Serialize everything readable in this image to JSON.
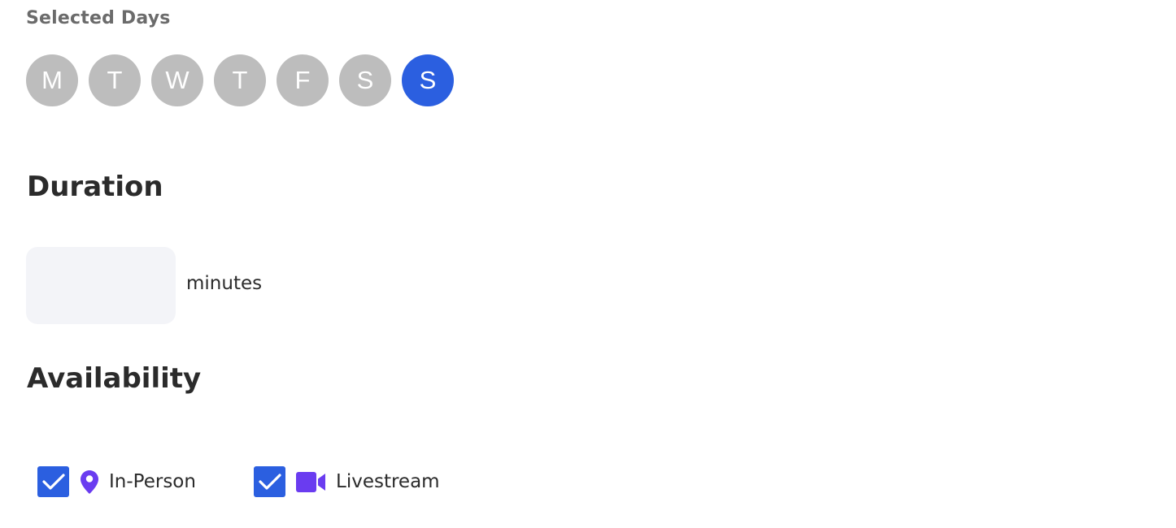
{
  "selected_days": {
    "label": "Selected Days",
    "days": [
      {
        "letter": "M",
        "selected": false
      },
      {
        "letter": "T",
        "selected": false
      },
      {
        "letter": "W",
        "selected": false
      },
      {
        "letter": "T",
        "selected": false
      },
      {
        "letter": "F",
        "selected": false
      },
      {
        "letter": "S",
        "selected": false
      },
      {
        "letter": "S",
        "selected": true
      }
    ]
  },
  "duration": {
    "title": "Duration",
    "value": "",
    "unit": "minutes"
  },
  "availability": {
    "title": "Availability",
    "options": [
      {
        "label": "In-Person",
        "checked": true,
        "icon": "location-pin-icon"
      },
      {
        "label": "Livestream",
        "checked": true,
        "icon": "video-camera-icon"
      }
    ]
  },
  "colors": {
    "accent": "#2b5fe0",
    "day_inactive": "#bdbdbd",
    "icon_purple": "#6a3cf0",
    "input_bg": "#f3f4f8"
  }
}
